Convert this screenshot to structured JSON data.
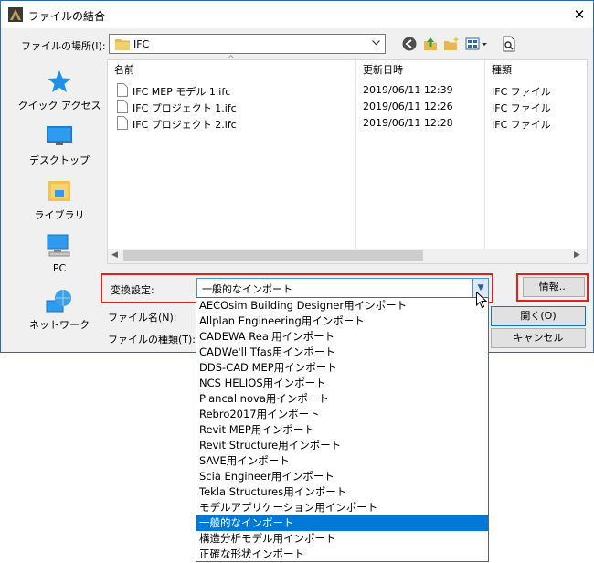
{
  "window": {
    "title": "ファイルの結合",
    "close_glyph": "✕"
  },
  "lookin": {
    "label": "ファイルの場所(I):",
    "value": "IFC"
  },
  "places": [
    {
      "label": "クイック アクセス",
      "icon": "star-icon"
    },
    {
      "label": "デスクトップ",
      "icon": "desktop-icon"
    },
    {
      "label": "ライブラリ",
      "icon": "library-icon"
    },
    {
      "label": "PC",
      "icon": "pc-icon"
    },
    {
      "label": "ネットワーク",
      "icon": "network-icon"
    }
  ],
  "filelist": {
    "columns": [
      "名前",
      "更新日時",
      "種類"
    ],
    "rows": [
      {
        "name": "IFC MEP モデル 1.ifc",
        "date": "2019/06/11 12:39",
        "type": "IFC ファイル"
      },
      {
        "name": "IFC プロジェクト 1.ifc",
        "date": "2019/06/11 12:26",
        "type": "IFC ファイル"
      },
      {
        "name": "IFC プロジェクト 2.ifc",
        "date": "2019/06/11 12:28",
        "type": "IFC ファイル"
      }
    ]
  },
  "conversion": {
    "label": "変換設定:",
    "value": "一般的なインポート",
    "info_button": "情報..."
  },
  "filename": {
    "label": "ファイル名(N):"
  },
  "filetype": {
    "label": "ファイルの種類(T):"
  },
  "buttons": {
    "open": "開く(O)",
    "cancel": "キャンセル"
  },
  "dropdown": {
    "selected_index": 15,
    "options": [
      "AECOsim Building Designer用インポート",
      "Allplan Engineering用インポート",
      "CADEWA Real用インポート",
      "CADWe'll Tfas用インポート",
      "DDS-CAD MEP用インポート",
      "NCS HELIOS用インポート",
      "Plancal nova用インポート",
      "Rebro2017用インポート",
      "Revit MEP用インポート",
      "Revit Structure用インポート",
      "SAVE用インポート",
      "Scia Engineer用インポート",
      "Tekla Structures用インポート",
      "モデルアプリケーション用インポート",
      "一般的なインポート",
      "構造分析モデル用インポート",
      "正確な形状インポート"
    ]
  },
  "colors": {
    "highlight": "#0078d7",
    "red_outline": "#e0201a",
    "accent_blue": "#2b6cb0"
  }
}
